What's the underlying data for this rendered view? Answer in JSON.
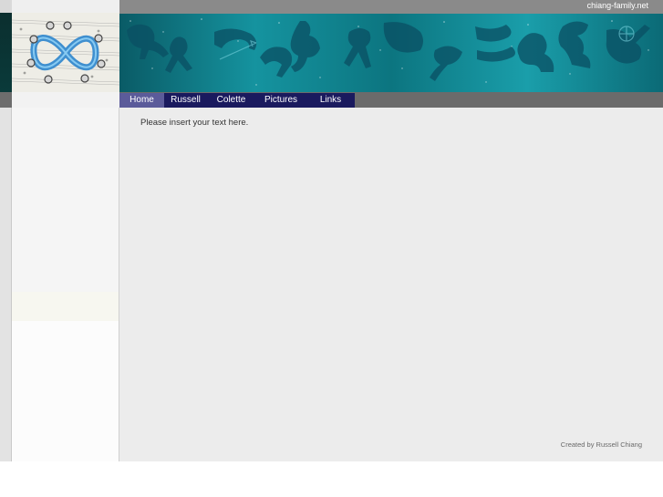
{
  "header": {
    "site_name": "chiang-family.net"
  },
  "nav": {
    "items": [
      {
        "label": "Home",
        "active": true
      },
      {
        "label": "Russell",
        "active": false
      },
      {
        "label": "Colette",
        "active": false
      },
      {
        "label": "Pictures",
        "active": false
      },
      {
        "label": "Links",
        "active": false
      }
    ]
  },
  "main": {
    "intro_text": "Please insert your text here."
  },
  "footer": {
    "credit": "Created by Russell Chiang"
  },
  "colors": {
    "nav_bg": "#1a1a5e",
    "nav_active_bg": "#5b5b9a",
    "banner_teal": "#1a9aa6",
    "content_bg": "#ececec"
  },
  "images": {
    "logo": "infinity-chain-logo",
    "banner": "zodiac-constellations-banner"
  }
}
